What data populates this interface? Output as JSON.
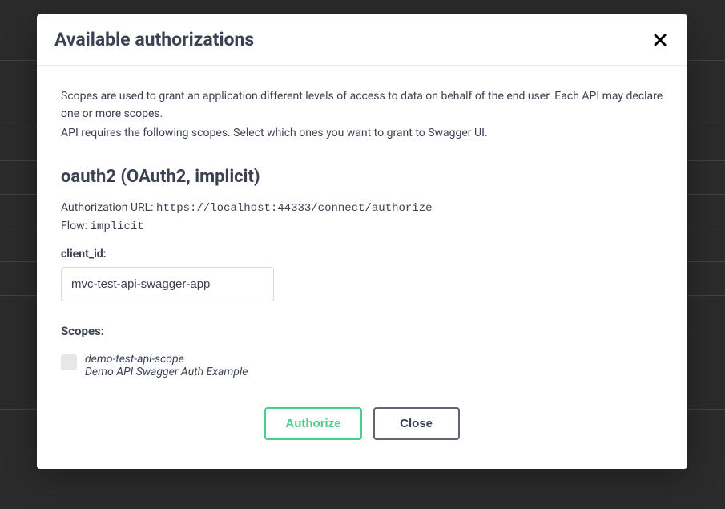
{
  "modal": {
    "title": "Available authorizations",
    "info1": "Scopes are used to grant an application different levels of access to data on behalf of the end user. Each API may declare one or more scopes.",
    "info2": "API requires the following scopes. Select which ones you want to grant to Swagger UI."
  },
  "auth": {
    "heading": "oauth2 (OAuth2, implicit)",
    "auth_url_label": "Authorization URL: ",
    "auth_url": "https://localhost:44333/connect/authorize",
    "flow_label": "Flow: ",
    "flow": "implicit",
    "client_id_label": "client_id:",
    "client_id_value": "mvc-test-api-swagger-app",
    "scopes_label": "Scopes:",
    "scopes": [
      {
        "name": "demo-test-api-scope",
        "desc": "Demo API Swagger Auth Example"
      }
    ]
  },
  "buttons": {
    "authorize": "Authorize",
    "close": "Close"
  }
}
